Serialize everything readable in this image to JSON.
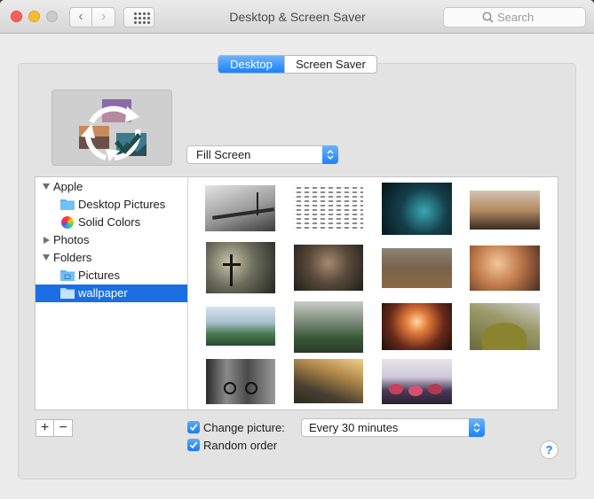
{
  "window": {
    "title": "Desktop & Screen Saver",
    "search_placeholder": "Search"
  },
  "tabs": [
    {
      "label": "Desktop",
      "selected": true
    },
    {
      "label": "Screen Saver",
      "selected": false
    }
  ],
  "fill_mode": {
    "selected": "Fill Screen"
  },
  "sidebar": {
    "groups": [
      {
        "label": "Apple",
        "expanded": true,
        "items": [
          "Desktop Pictures",
          "Solid Colors"
        ]
      },
      {
        "label": "Photos",
        "expanded": false,
        "items": []
      },
      {
        "label": "Folders",
        "expanded": true,
        "items": [
          "Pictures",
          "wallpaper"
        ]
      }
    ],
    "selected_item": "wallpaper"
  },
  "buttons": {
    "add": "+",
    "remove": "−",
    "help": "?"
  },
  "options": {
    "change_picture": {
      "label": "Change picture:",
      "checked": true
    },
    "interval": {
      "selected": "Every 30 minutes"
    },
    "random_order": {
      "label": "Random order",
      "checked": true
    }
  },
  "colors": {
    "accent": "#1a82fb",
    "selection": "#1b6fe2"
  }
}
